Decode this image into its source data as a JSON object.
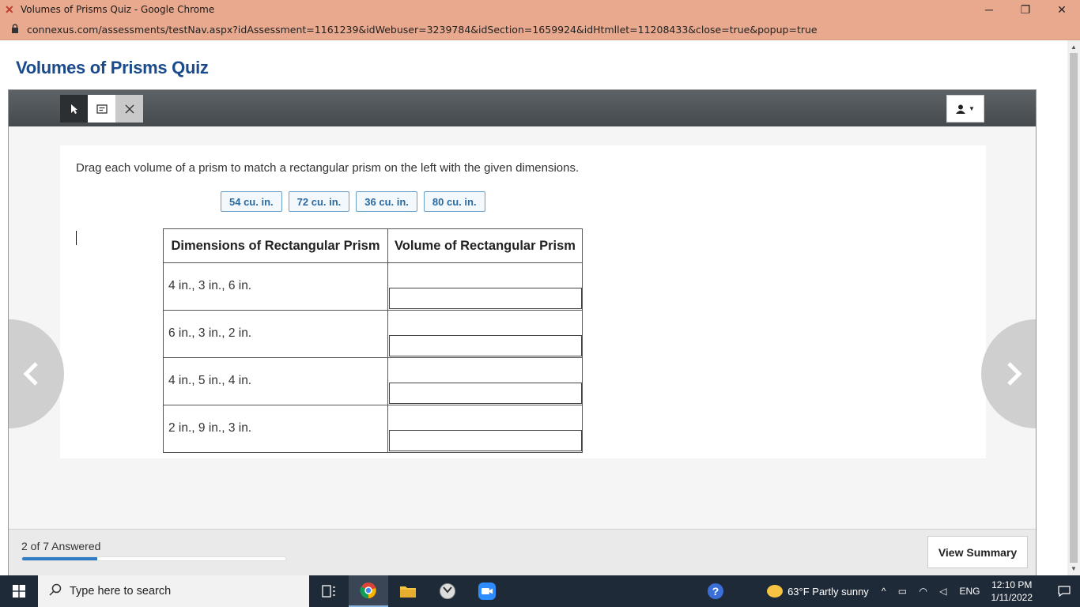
{
  "window": {
    "title": "Volumes of Prisms Quiz - Google Chrome",
    "minimize": "─",
    "restore": "❐",
    "close": "✕"
  },
  "address": {
    "url": "connexus.com/assessments/testNav.aspx?idAssessment=1161239&idWebuser=3239784&idSection=1659924&idHtmllet=11208433&close=true&popup=true"
  },
  "quiz": {
    "title": "Volumes of Prisms Quiz",
    "instruction": "Drag each volume of a prism to match a rectangular prism on the left with the given dimensions.",
    "choices": [
      "54 cu. in.",
      "72 cu. in.",
      "36 cu. in.",
      "80 cu. in."
    ],
    "table": {
      "headers": [
        "Dimensions of Rectangular Prism",
        "Volume of Rectangular Prism"
      ],
      "rows": [
        "4 in., 3 in., 6 in.",
        "6 in., 3 in., 2 in.",
        "4 in., 5 in., 4 in.",
        "2 in., 9 in., 3 in."
      ]
    }
  },
  "footer": {
    "answered": "2 of 7 Answered",
    "progress_fraction": 0.286,
    "summary_button": "View Summary"
  },
  "taskbar": {
    "search_placeholder": "Type here to search",
    "weather": "63°F  Partly sunny",
    "language": "ENG",
    "time": "12:10 PM",
    "date": "1/11/2022"
  }
}
